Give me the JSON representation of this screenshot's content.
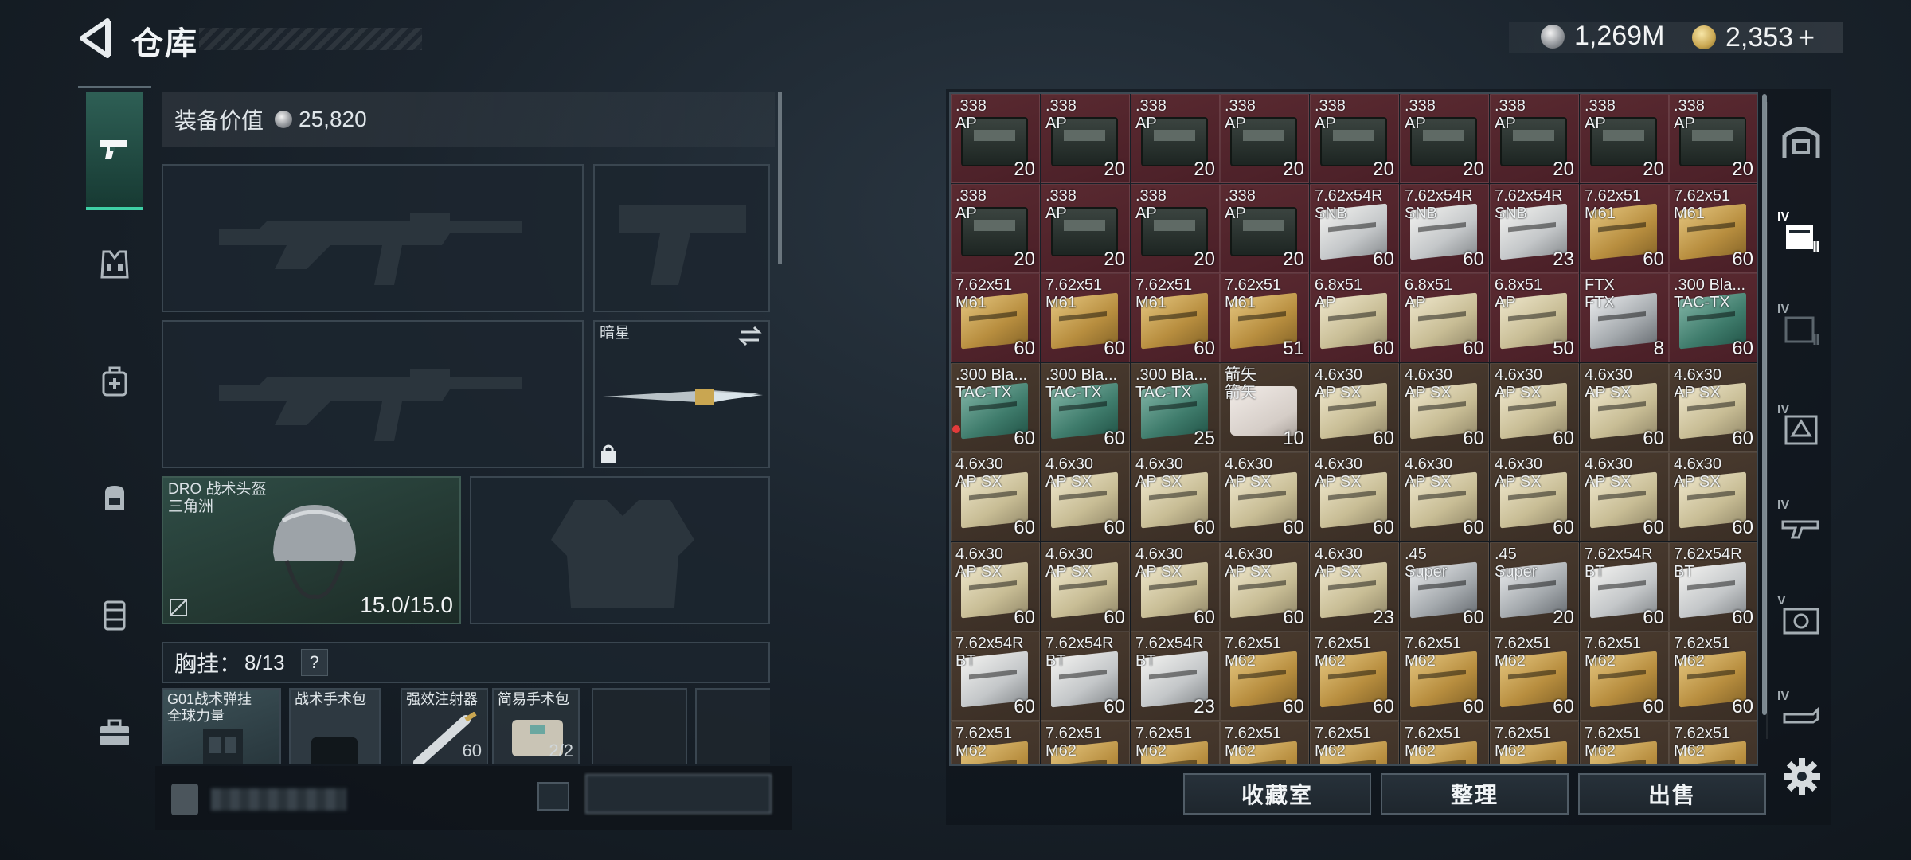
{
  "header": {
    "title": "仓库",
    "currency": [
      {
        "kind": "silver",
        "value": "1,269M"
      },
      {
        "kind": "gold",
        "value": "2,353"
      }
    ],
    "add_symbol": "+"
  },
  "left_tabs": [
    {
      "name": "weapons",
      "icon": "pistol-icon",
      "active": true
    },
    {
      "name": "vest",
      "icon": "vest-icon"
    },
    {
      "name": "medical",
      "icon": "medkit-icon"
    },
    {
      "name": "backpack",
      "icon": "backpack-icon"
    },
    {
      "name": "container",
      "icon": "container-icon"
    },
    {
      "name": "toolbox",
      "icon": "toolbox-icon"
    }
  ],
  "loadout": {
    "equip_value_label": "装备价值",
    "equip_value": "25,820",
    "melee_label": "暗星",
    "helmet_name_line1": "DRO 战术头盔",
    "helmet_name_line2": "三角洲",
    "helmet_durability": "15.0/15.0",
    "rig_label": "胸挂：",
    "rig_count": "8/13",
    "rig_help": "?",
    "rig_items": {
      "g01_line1": "G01战术弹挂",
      "g01_line2": "全球力量",
      "surgery1": "战术手术包",
      "injector": "强效注射器",
      "injector_count": "60",
      "surgery2": "简易手术包",
      "surgery2_count": "2/2"
    }
  },
  "stash": {
    "columns": 9,
    "rows": [
      [
        {
          "name": ".338\nAP",
          "qty": "20",
          "bg": "red",
          "art": "crate"
        },
        {
          "name": ".338\nAP",
          "qty": "20",
          "bg": "red",
          "art": "crate"
        },
        {
          "name": ".338\nAP",
          "qty": "20",
          "bg": "red",
          "art": "crate"
        },
        {
          "name": ".338\nAP",
          "qty": "20",
          "bg": "red",
          "art": "crate"
        },
        {
          "name": ".338\nAP",
          "qty": "20",
          "bg": "red",
          "art": "crate"
        },
        {
          "name": ".338\nAP",
          "qty": "20",
          "bg": "red",
          "art": "crate"
        },
        {
          "name": ".338\nAP",
          "qty": "20",
          "bg": "red",
          "art": "crate"
        },
        {
          "name": ".338\nAP",
          "qty": "20",
          "bg": "red",
          "art": "crate"
        },
        {
          "name": ".338\nAP",
          "qty": "20",
          "bg": "red",
          "art": "crate"
        }
      ],
      [
        {
          "name": ".338\nAP",
          "qty": "20",
          "bg": "red",
          "art": "crate"
        },
        {
          "name": ".338\nAP",
          "qty": "20",
          "bg": "red",
          "art": "crate"
        },
        {
          "name": ".338\nAP",
          "qty": "20",
          "bg": "red",
          "art": "crate"
        },
        {
          "name": ".338\nAP",
          "qty": "20",
          "bg": "red",
          "art": "crate"
        },
        {
          "name": "7.62x54R\nSNB",
          "qty": "60",
          "bg": "red",
          "art": "white"
        },
        {
          "name": "7.62x54R\nSNB",
          "qty": "60",
          "bg": "red",
          "art": "white"
        },
        {
          "name": "7.62x54R\nSNB",
          "qty": "23",
          "bg": "red",
          "art": "white"
        },
        {
          "name": "7.62x51\nM61",
          "qty": "60",
          "bg": "red",
          "art": "gold"
        },
        {
          "name": "7.62x51\nM61",
          "qty": "60",
          "bg": "red",
          "art": "gold"
        }
      ],
      [
        {
          "name": "7.62x51\nM61",
          "qty": "60",
          "bg": "red",
          "art": "gold"
        },
        {
          "name": "7.62x51\nM61",
          "qty": "60",
          "bg": "red",
          "art": "gold"
        },
        {
          "name": "7.62x51\nM61",
          "qty": "60",
          "bg": "red",
          "art": "gold"
        },
        {
          "name": "7.62x51\nM61",
          "qty": "51",
          "bg": "red",
          "art": "gold"
        },
        {
          "name": "6.8x51\nAP",
          "qty": "60",
          "bg": "red",
          "art": "cream"
        },
        {
          "name": "6.8x51\nAP",
          "qty": "60",
          "bg": "red",
          "art": "cream"
        },
        {
          "name": "6.8x51\nAP",
          "qty": "50",
          "bg": "red",
          "art": "cream"
        },
        {
          "name": "FTX\nFTX",
          "qty": "8",
          "bg": "red",
          "art": "silver"
        },
        {
          "name": ".300 Bla...\nTAC-TX",
          "qty": "60",
          "bg": "red",
          "art": "teal"
        }
      ],
      [
        {
          "name": ".300 Bla...\nTAC-TX",
          "qty": "60",
          "bg": "brown",
          "art": "teal"
        },
        {
          "name": ".300 Bla...\nTAC-TX",
          "qty": "60",
          "bg": "brown",
          "art": "teal"
        },
        {
          "name": ".300 Bla...\nTAC-TX",
          "qty": "25",
          "bg": "brown",
          "art": "teal"
        },
        {
          "name": "箭矢\n箭矢",
          "qty": "10",
          "bg": "brown",
          "art": "arrow"
        },
        {
          "name": "4.6x30\nAP SX",
          "qty": "60",
          "bg": "brown",
          "art": "cream"
        },
        {
          "name": "4.6x30\nAP SX",
          "qty": "60",
          "bg": "brown",
          "art": "cream"
        },
        {
          "name": "4.6x30\nAP SX",
          "qty": "60",
          "bg": "brown",
          "art": "cream"
        },
        {
          "name": "4.6x30\nAP SX",
          "qty": "60",
          "bg": "brown",
          "art": "cream"
        },
        {
          "name": "4.6x30\nAP SX",
          "qty": "60",
          "bg": "brown",
          "art": "cream"
        }
      ],
      [
        {
          "name": "4.6x30\nAP SX",
          "qty": "60",
          "bg": "brown",
          "art": "cream"
        },
        {
          "name": "4.6x30\nAP SX",
          "qty": "60",
          "bg": "brown",
          "art": "cream"
        },
        {
          "name": "4.6x30\nAP SX",
          "qty": "60",
          "bg": "brown",
          "art": "cream"
        },
        {
          "name": "4.6x30\nAP SX",
          "qty": "60",
          "bg": "brown",
          "art": "cream"
        },
        {
          "name": "4.6x30\nAP SX",
          "qty": "60",
          "bg": "brown",
          "art": "cream"
        },
        {
          "name": "4.6x30\nAP SX",
          "qty": "60",
          "bg": "brown",
          "art": "cream"
        },
        {
          "name": "4.6x30\nAP SX",
          "qty": "60",
          "bg": "brown",
          "art": "cream"
        },
        {
          "name": "4.6x30\nAP SX",
          "qty": "60",
          "bg": "brown",
          "art": "cream"
        },
        {
          "name": "4.6x30\nAP SX",
          "qty": "60",
          "bg": "brown",
          "art": "cream"
        }
      ],
      [
        {
          "name": "4.6x30\nAP SX",
          "qty": "60",
          "bg": "brown",
          "art": "cream"
        },
        {
          "name": "4.6x30\nAP SX",
          "qty": "60",
          "bg": "brown",
          "art": "cream"
        },
        {
          "name": "4.6x30\nAP SX",
          "qty": "60",
          "bg": "brown",
          "art": "cream"
        },
        {
          "name": "4.6x30\nAP SX",
          "qty": "60",
          "bg": "brown",
          "art": "cream"
        },
        {
          "name": "4.6x30\nAP SX",
          "qty": "23",
          "bg": "brown",
          "art": "cream"
        },
        {
          "name": ".45\nSuper",
          "qty": "60",
          "bg": "brown",
          "art": "silver"
        },
        {
          "name": ".45\nSuper",
          "qty": "20",
          "bg": "brown",
          "art": "silver"
        },
        {
          "name": "7.62x54R\nBT",
          "qty": "60",
          "bg": "brown",
          "art": "white"
        },
        {
          "name": "7.62x54R\nBT",
          "qty": "60",
          "bg": "brown",
          "art": "white"
        }
      ],
      [
        {
          "name": "7.62x54R\nBT",
          "qty": "60",
          "bg": "brown",
          "art": "white"
        },
        {
          "name": "7.62x54R\nBT",
          "qty": "60",
          "bg": "brown",
          "art": "white"
        },
        {
          "name": "7.62x54R\nBT",
          "qty": "23",
          "bg": "brown",
          "art": "white"
        },
        {
          "name": "7.62x51\nM62",
          "qty": "60",
          "bg": "brown",
          "art": "gold"
        },
        {
          "name": "7.62x51\nM62",
          "qty": "60",
          "bg": "brown",
          "art": "gold"
        },
        {
          "name": "7.62x51\nM62",
          "qty": "60",
          "bg": "brown",
          "art": "gold"
        },
        {
          "name": "7.62x51\nM62",
          "qty": "60",
          "bg": "brown",
          "art": "gold"
        },
        {
          "name": "7.62x51\nM62",
          "qty": "60",
          "bg": "brown",
          "art": "gold"
        },
        {
          "name": "7.62x51\nM62",
          "qty": "60",
          "bg": "brown",
          "art": "gold"
        }
      ],
      [
        {
          "name": "7.62x51\nM62",
          "qty": "",
          "bg": "brown",
          "art": "gold"
        },
        {
          "name": "7.62x51\nM62",
          "qty": "",
          "bg": "brown",
          "art": "gold"
        },
        {
          "name": "7.62x51\nM62",
          "qty": "",
          "bg": "brown",
          "art": "gold"
        },
        {
          "name": "7.62x51\nM62",
          "qty": "",
          "bg": "brown",
          "art": "gold"
        },
        {
          "name": "7.62x51\nM62",
          "qty": "",
          "bg": "brown",
          "art": "gold"
        },
        {
          "name": "7.62x51\nM62",
          "qty": "",
          "bg": "brown",
          "art": "gold"
        },
        {
          "name": "7.62x51\nM62",
          "qty": "",
          "bg": "brown",
          "art": "gold"
        },
        {
          "name": "7.62x51\nM62",
          "qty": "",
          "bg": "brown",
          "art": "gold"
        },
        {
          "name": "7.62x51\nM62",
          "qty": "",
          "bg": "brown",
          "art": "gold"
        }
      ]
    ]
  },
  "stash_buttons": {
    "collection": "收藏室",
    "organize": "整理",
    "sell": "出售"
  },
  "right_tabs": [
    {
      "icon": "safe-box-icon",
      "level": ""
    },
    {
      "icon": "file-cabinet-icon",
      "level": "IV",
      "active": true
    },
    {
      "icon": "file-cabinet-icon",
      "level": "IV"
    },
    {
      "icon": "armor-storage-icon",
      "level": "IV"
    },
    {
      "icon": "gun-rack-icon",
      "level": "IV"
    },
    {
      "icon": "med-station-icon",
      "level": "V"
    },
    {
      "icon": "workbench-icon",
      "level": "IV"
    }
  ],
  "colors": {
    "accent": "#3fd0a6",
    "stash_red": "#4a1f27",
    "stash_brown": "#3a2e25",
    "panel": "#1c262f"
  }
}
